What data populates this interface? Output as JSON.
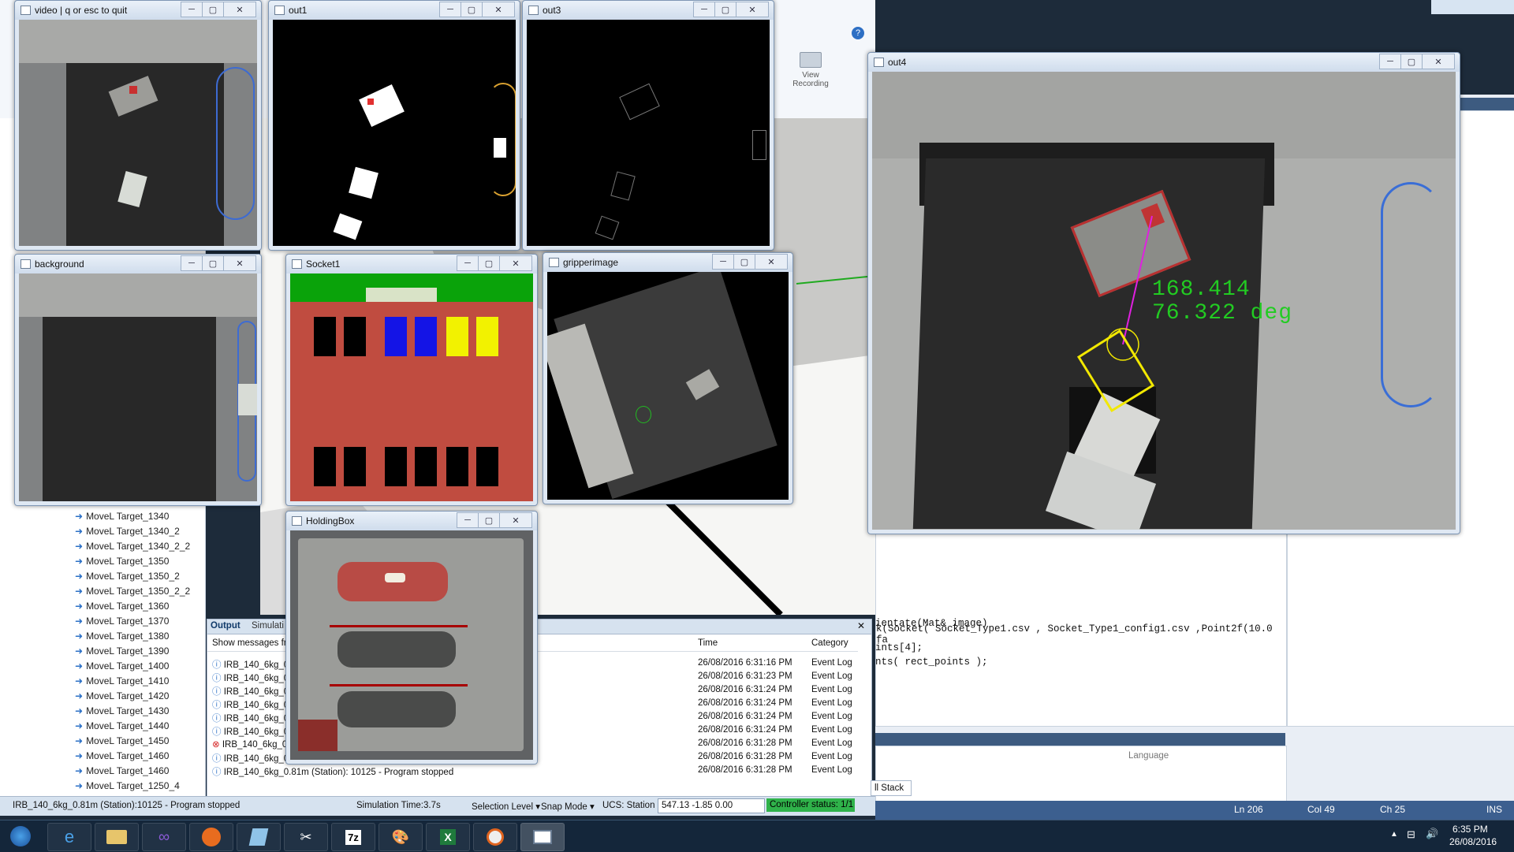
{
  "ribbon": {
    "view_recording_label": "View Recording"
  },
  "tree": {
    "items": [
      "MoveL Target_1340",
      "MoveL Target_1340_2",
      "MoveL Target_1340_2_2",
      "MoveL Target_1350",
      "MoveL Target_1350_2",
      "MoveL Target_1350_2_2",
      "MoveL Target_1360",
      "MoveL Target_1370",
      "MoveL Target_1380",
      "MoveL Target_1390",
      "MoveL Target_1400",
      "MoveL Target_1410",
      "MoveL Target_1420",
      "MoveL Target_1430",
      "MoveL Target_1440",
      "MoveL Target_1450",
      "MoveL Target_1460",
      "MoveL Target_1460",
      "MoveL Target_1250_4"
    ]
  },
  "output": {
    "tab_output": "Output",
    "tab_simulation": "Simulati",
    "show_messages": "Show messages fro",
    "col_time": "Time",
    "col_category": "Category",
    "rows": [
      {
        "msg": "IRB_140_6kg_0",
        "time": "26/08/2016 6:31:16 PM",
        "cat": "Event Log",
        "err": false
      },
      {
        "msg": "IRB_140_6kg_0",
        "time": "26/08/2016 6:31:23 PM",
        "cat": "Event Log",
        "err": false
      },
      {
        "msg": "IRB_140_6kg_0",
        "time": "26/08/2016 6:31:24 PM",
        "cat": "Event Log",
        "err": false
      },
      {
        "msg": "IRB_140_6kg_0",
        "time": "26/08/2016 6:31:24 PM",
        "cat": "Event Log",
        "err": false
      },
      {
        "msg": "IRB_140_6kg_0",
        "time": "26/08/2016 6:31:24 PM",
        "cat": "Event Log",
        "err": false
      },
      {
        "msg": "IRB_140_6kg_0",
        "time": "26/08/2016 6:31:24 PM",
        "cat": "Event Log",
        "err": false
      },
      {
        "msg": "IRB_140_6kg_0",
        "time": "26/08/2016 6:31:28 PM",
        "cat": "Event Log",
        "err": true
      },
      {
        "msg": "IRB_140_6kg_0",
        "time": "26/08/2016 6:31:28 PM",
        "cat": "Event Log",
        "err": false
      },
      {
        "msg": "IRB_140_6kg_0.81m (Station): 10125 - Program stopped",
        "time": "26/08/2016 6:31:28 PM",
        "cat": "Event Log",
        "err": false
      }
    ]
  },
  "status": {
    "message": "IRB_140_6kg_0.81m (Station):10125 - Program stopped",
    "sim_time": "Simulation Time:3.7s",
    "selection_level": "Selection Level ▾",
    "snap_mode": "Snap Mode ▾",
    "ucs": "UCS: Station",
    "coords": "547.13  -1.85  0.00",
    "controller": "Controller status: 1/1"
  },
  "code": {
    "line1": "k(Socket( Socket_Type1.csv , Socket_Type1_config1.csv ,Point2f(10.0 fa",
    "line2": "ientate(Mat& image)",
    "line3": "ints[4];",
    "line4": "nts( rect_points );"
  },
  "vs": {
    "language_header": "Language",
    "call_stack_tab": "ll Stack",
    "ln": "Ln 206",
    "col": "Col 49",
    "ch": "Ch 25",
    "ins": "INS"
  },
  "windows": {
    "video": "video | q or esc to quit",
    "out1": "out1",
    "out3": "out3",
    "out4": "out4",
    "background": "background",
    "socket1": "Socket1",
    "gripperimage": "gripperimage",
    "holdingbox": "HoldingBox"
  },
  "overlay": {
    "distance": "168.414",
    "angle": "76.322 deg"
  },
  "clock": {
    "time": "6:35 PM",
    "date": "26/08/2016"
  },
  "colors": {
    "green_text": "#22cc22",
    "magenta_line": "#e020e0",
    "yellow_box": "#f2e800"
  }
}
